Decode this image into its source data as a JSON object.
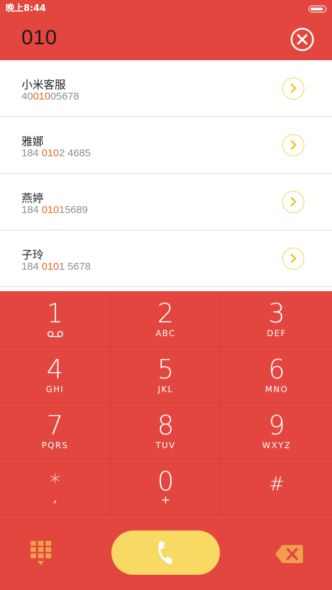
{
  "status_bar": {
    "time": "晚上8:44",
    "battery_level": 0.9
  },
  "header": {
    "dialed_number": "010"
  },
  "results": [
    {
      "name": "小米客服",
      "number_pre": "40",
      "number_match": "010",
      "number_post": "05678"
    },
    {
      "name": "雅娜",
      "number_pre": "184 ",
      "number_match": "010",
      "number_post": "2 4685"
    },
    {
      "name": "燕婷",
      "number_pre": "184 ",
      "number_match": "010",
      "number_post": "15689"
    },
    {
      "name": "子玲",
      "number_pre": "184 ",
      "number_match": "010",
      "number_post": "1 5678"
    }
  ],
  "keypad": {
    "keys": [
      {
        "digit": "1",
        "letters": ""
      },
      {
        "digit": "2",
        "letters": "ABC"
      },
      {
        "digit": "3",
        "letters": "DEF"
      },
      {
        "digit": "4",
        "letters": "GHI"
      },
      {
        "digit": "5",
        "letters": "JKL"
      },
      {
        "digit": "6",
        "letters": "MNO"
      },
      {
        "digit": "7",
        "letters": "PQRS"
      },
      {
        "digit": "8",
        "letters": "TUV"
      },
      {
        "digit": "9",
        "letters": "WXYZ"
      },
      {
        "digit": "*",
        "letters": ","
      },
      {
        "digit": "0",
        "letters": "+"
      },
      {
        "digit": "#",
        "letters": ""
      }
    ]
  },
  "icons": {
    "clear": "close-circle-icon",
    "detail": "chevron-right-icon",
    "voicemail": "voicemail-icon",
    "keypad_toggle": "dialpad-icon",
    "call": "phone-icon",
    "backspace": "backspace-icon"
  },
  "colors": {
    "primary_red": "#e3463f",
    "accent_yellow": "#f7d964",
    "match_orange": "#f0641e",
    "icon_orange": "#f0a04b"
  }
}
